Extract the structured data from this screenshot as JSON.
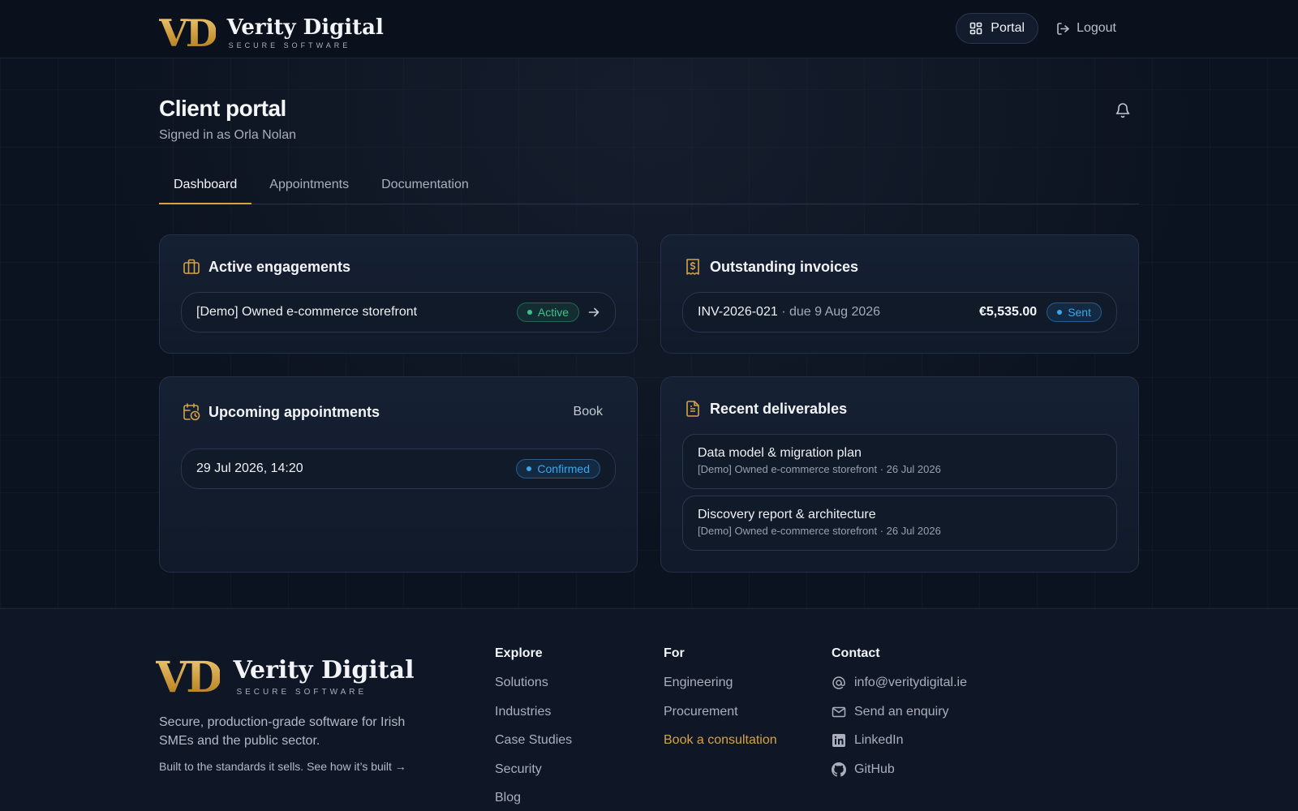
{
  "brand": {
    "mark": "VD",
    "name": "Verity Digital",
    "tagline": "SECURE SOFTWARE"
  },
  "nav": {
    "portal_label": "Portal",
    "logout_label": "Logout"
  },
  "page": {
    "title": "Client portal",
    "subtitle": "Signed in as Orla Nolan"
  },
  "tabs": [
    {
      "label": "Dashboard",
      "active": true
    },
    {
      "label": "Appointments",
      "active": false
    },
    {
      "label": "Documentation",
      "active": false
    }
  ],
  "engagements": {
    "title": "Active engagements",
    "items": [
      {
        "name": "[Demo] Owned e-commerce storefront",
        "status": "Active"
      }
    ]
  },
  "invoices": {
    "title": "Outstanding invoices",
    "items": [
      {
        "number": "INV-2026-021",
        "due": "· due 9 Aug 2026",
        "amount": "€5,535.00",
        "status": "Sent"
      }
    ]
  },
  "appointments": {
    "title": "Upcoming appointments",
    "book_label": "Book",
    "items": [
      {
        "when": "29 Jul 2026, 14:20",
        "status": "Confirmed"
      }
    ]
  },
  "deliverables": {
    "title": "Recent deliverables",
    "items": [
      {
        "title": "Data model & migration plan",
        "meta": "[Demo] Owned e-commerce storefront · 26 Jul 2026"
      },
      {
        "title": "Discovery report & architecture",
        "meta": "[Demo] Owned e-commerce storefront · 26 Jul 2026"
      }
    ]
  },
  "footer": {
    "description": "Secure, production-grade software for Irish SMEs and the public sector.",
    "built_link": "Built to the standards it sells. See how it’s built →",
    "explore": {
      "heading": "Explore",
      "items": [
        "Solutions",
        "Industries",
        "Case Studies",
        "Security",
        "Blog"
      ]
    },
    "for": {
      "heading": "For",
      "items": [
        "Engineering",
        "Procurement",
        "Book a consultation"
      ]
    },
    "contact": {
      "heading": "Contact",
      "items": [
        {
          "label": "info@veritydigital.ie",
          "icon": "at-icon"
        },
        {
          "label": "Send an enquiry",
          "icon": "mail-icon"
        },
        {
          "label": "LinkedIn",
          "icon": "linkedin-icon"
        },
        {
          "label": "GitHub",
          "icon": "github-icon"
        }
      ]
    }
  },
  "colors": {
    "accent_gold": "#d4a348",
    "active_green": "#3fc28a",
    "info_blue": "#3aa7ec",
    "background": "#0c1320"
  }
}
